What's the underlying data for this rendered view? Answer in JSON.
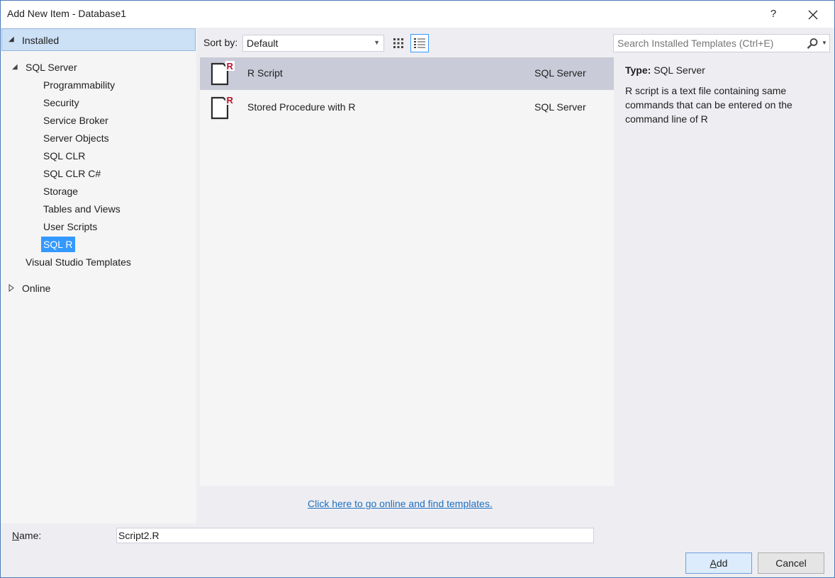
{
  "window": {
    "title": "Add New Item - Database1",
    "help_label": "?"
  },
  "left_pane": {
    "installed_label": "Installed",
    "sql_server_label": "SQL Server",
    "items": [
      {
        "label": "Programmability"
      },
      {
        "label": "Security"
      },
      {
        "label": "Service Broker"
      },
      {
        "label": "Server Objects"
      },
      {
        "label": "SQL CLR"
      },
      {
        "label": "SQL CLR C#"
      },
      {
        "label": "Storage"
      },
      {
        "label": "Tables and Views"
      },
      {
        "label": "User Scripts"
      },
      {
        "label": "SQL R",
        "selected": true
      }
    ],
    "vs_templates_label": "Visual Studio Templates",
    "online_label": "Online"
  },
  "toolbar": {
    "sort_by_label": "Sort by:",
    "sort_value": "Default",
    "search_placeholder": "Search Installed Templates (Ctrl+E)"
  },
  "templates": [
    {
      "name": "R Script",
      "category": "SQL Server",
      "selected": true
    },
    {
      "name": "Stored Procedure with R",
      "category": "SQL Server",
      "selected": false
    }
  ],
  "online_link": "Click here to go online and find templates.",
  "description": {
    "type_label": "Type:",
    "type_value": "SQL Server",
    "text": "R script is a text file containing same commands that can be entered on the command line of R"
  },
  "bottom": {
    "name_label_prefix": "N",
    "name_label_rest": "ame:",
    "name_value": "Script2.R",
    "add_prefix": "A",
    "add_rest": "dd",
    "cancel_label": "Cancel"
  },
  "colors": {
    "accent": "#3399ff",
    "selected_header": "#cce0f6",
    "selected_row": "#c9cbd8",
    "r_badge": "#c0102c",
    "link": "#1e6fbf"
  },
  "icons": {
    "close": "close-icon",
    "expanded": "expanded-triangle-icon",
    "collapsed": "collapsed-triangle-icon",
    "small_icons_view": "small-icons-view-icon",
    "list_view": "list-view-icon",
    "search": "search-icon",
    "dropdown": "chevron-down-icon",
    "r_file": "r-file-icon"
  }
}
